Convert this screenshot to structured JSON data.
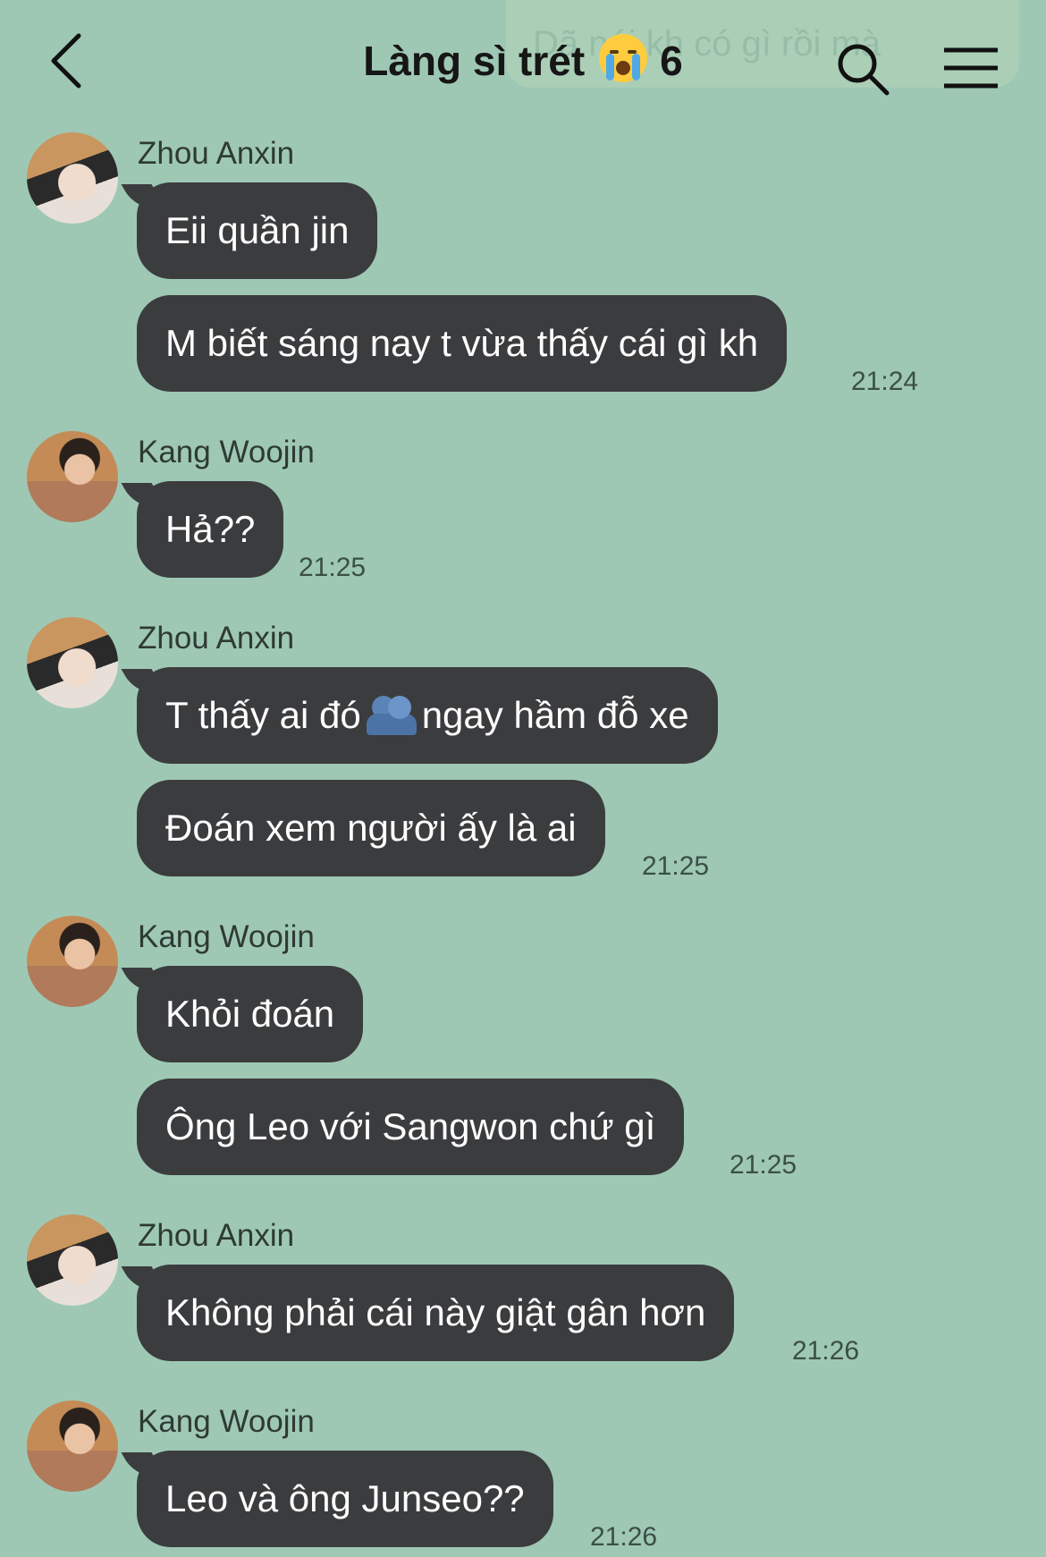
{
  "header": {
    "title": "Làng sì trét",
    "member_count": "6",
    "title_emoji": "loudly-crying-face-emoji",
    "ghost_text": "Dã nói kh có gì rồi mà",
    "back_icon": "chevron-left-icon",
    "search_icon": "search-icon",
    "menu_icon": "hamburger-menu-icon"
  },
  "colors": {
    "background": "#9ec8b4",
    "bubble": "#3b3c3e",
    "bubble_text": "#ffffff",
    "meta_text": "#3b4f46"
  },
  "messages": [
    {
      "sender": "Zhou Anxin",
      "avatar": "zhou-anxin-avatar",
      "bubbles": [
        "Eii quần jin",
        "M biết sáng nay t vừa thấy cái gì kh"
      ],
      "time": "21:24"
    },
    {
      "sender": "Kang Woojin",
      "avatar": "kang-woojin-avatar",
      "bubbles": [
        "Hả??"
      ],
      "time": "21:25"
    },
    {
      "sender": "Zhou Anxin",
      "avatar": "zhou-anxin-avatar",
      "bubbles": [
        "T thấy ai đó",
        "ngay hầm đỗ xe",
        "Đoán xem người ấy là ai"
      ],
      "time": "21:25",
      "inline_emoji": "busts-in-silhouette-emoji"
    },
    {
      "sender": "Kang Woojin",
      "avatar": "kang-woojin-avatar",
      "bubbles": [
        "Khỏi đoán",
        "Ông Leo với Sangwon chứ gì"
      ],
      "time": "21:25"
    },
    {
      "sender": "Zhou Anxin",
      "avatar": "zhou-anxin-avatar",
      "bubbles": [
        "Không phải cái này giật gân hơn"
      ],
      "time": "21:26"
    },
    {
      "sender": "Kang Woojin",
      "avatar": "kang-woojin-avatar",
      "bubbles": [
        "Leo và ông Junseo??"
      ],
      "time": "21:26"
    }
  ]
}
